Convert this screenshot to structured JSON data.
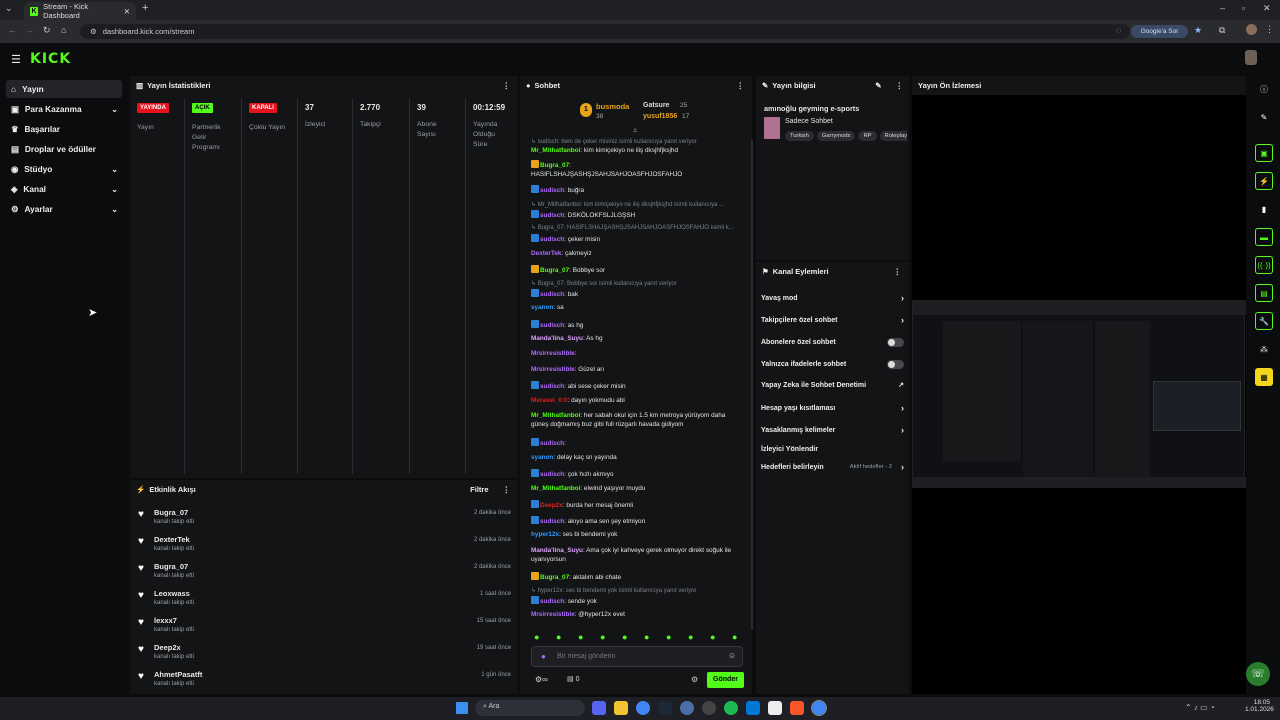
{
  "browser": {
    "tab_title": "Stream - Kick Dashboard",
    "url": "dashboard.kick.com/stream",
    "google_label": "Google'a Sor"
  },
  "sidebar": {
    "items": [
      {
        "label": "Yayın"
      },
      {
        "label": "Para Kazanma"
      },
      {
        "label": "Başarılar"
      },
      {
        "label": "Droplar ve ödüller"
      },
      {
        "label": "Stüdyo"
      },
      {
        "label": "Kanal"
      },
      {
        "label": "Ayarlar"
      }
    ]
  },
  "stats": {
    "title": "Yayın İstatistikleri",
    "badges": [
      {
        "text": "YAYINDA",
        "label": "Yayın"
      },
      {
        "text": "AÇIK",
        "label": "Partnerlik Gelir Programı"
      },
      {
        "text": "KAPALI",
        "label": "Çoklu Yayın"
      }
    ],
    "values": [
      {
        "value": "37",
        "label": "İzleyici"
      },
      {
        "value": "2.770",
        "label": "Takipçi"
      },
      {
        "value": "39",
        "label": "Abone Sayısı"
      },
      {
        "value": "00:12:59",
        "label": "Yayında Olduğu Süre"
      }
    ]
  },
  "activity": {
    "title": "Etkinlik Akışı",
    "filter": "Filtre",
    "rows": [
      {
        "name": "Bugra_07",
        "sub": "kanalı takip etti",
        "time": "2 dakika önce"
      },
      {
        "name": "DexterTek",
        "sub": "kanalı takip etti",
        "time": "2 dakika önce"
      },
      {
        "name": "Bugra_07",
        "sub": "kanalı takip etti",
        "time": "2 dakika önce"
      },
      {
        "name": "Leoxwass",
        "sub": "kanalı takip etti",
        "time": "1 saat önce"
      },
      {
        "name": "lexxx7",
        "sub": "kanalı takip etti",
        "time": "15 saat önce"
      },
      {
        "name": "Deep2x",
        "sub": "kanalı takip etti",
        "time": "19 saat önce"
      },
      {
        "name": "AhmetPasatft",
        "sub": "kanalı takip etti",
        "time": "1 gün önce"
      }
    ]
  },
  "chat": {
    "title": "Sohbet",
    "top": {
      "first": "busmoda",
      "first_count": "38",
      "second": "Gatsure",
      "second_count": "25",
      "third": "yusuf1856",
      "third_count": "17"
    },
    "messages": [
      {
        "reply": "sudisch: beni de çeker misiniz isimli kullanıcıya yanıt veriyor"
      },
      {
        "user": "Mr_Mithatfanboi",
        "color": "#53fc18",
        "text": "kim kimiçekiyo ne iliş dksjhfjksjhd"
      },
      {
        "user": "Bugra_07",
        "color": "#53fc18",
        "text": "",
        "badge": "#e8a31a"
      },
      {
        "text": "HASIFLSHAJŞASHŞJSAHJSAHJOASFHJOSFAHJO"
      },
      {
        "user": "sudisch",
        "color": "#b06bff",
        "text": "buğra",
        "badge": "#2d7fd6"
      },
      {
        "reply": "Mr_Mithatfanboi: kim kimiçekiyo ne iliş dksjhfjksjhd isimli kullanıcıya ..."
      },
      {
        "user": "sudisch",
        "color": "#b06bff",
        "text": "DSKÖLOKFSLJLGŞSH",
        "badge": "#2d7fd6"
      },
      {
        "reply": "Bugra_07: HASİFLSHAJŞASHŞJSAHJSAHJOASFHJOSFAHJO isimli k..."
      },
      {
        "user": "sudisch",
        "color": "#b06bff",
        "text": "çeker misin",
        "badge": "#2d7fd6"
      },
      {
        "user": "DexterTek",
        "color": "#b06bff",
        "text": "çakmeyiz"
      },
      {
        "user": "Bugra_07",
        "color": "#53fc18",
        "text": "Bobbye sor",
        "badge": "#e8a31a"
      },
      {
        "reply": "Bugra_07: Bobbye sor isimli kullanıcıya yanıt veriyor"
      },
      {
        "user": "sudisch",
        "color": "#b06bff",
        "text": "bak",
        "badge": "#2d7fd6"
      },
      {
        "user": "syanon",
        "color": "#2d9cff",
        "text": "sa"
      },
      {
        "user": "sudisch",
        "color": "#b06bff",
        "text": "as hg",
        "badge": "#2d7fd6"
      },
      {
        "user": "Manda'lina_Suyu",
        "color": "#e0a0ff",
        "text": "As hg"
      },
      {
        "user": "Mrsirresistible",
        "color": "#b06bff",
        "text": ""
      },
      {
        "user": "Mrsirresistible",
        "color": "#b06bff",
        "text": "Güzel arı"
      },
      {
        "user": "sudisch",
        "color": "#b06bff",
        "text": "abi sese çeker misin",
        "badge": "#2d7fd6"
      },
      {
        "user": "Merasel_0:0",
        "color": "#d22",
        "text": "dayın yokmudu abi"
      },
      {
        "user": "Mr_Mithatfanboi",
        "color": "#53fc18",
        "text": "her sabah okul için 1.5 km metroya yürüyom daha güneş doğmamış buz gibi full rüzgarlı havada gidiyom"
      },
      {
        "user": "sudisch",
        "color": "#b06bff",
        "text": "",
        "badge": "#2d7fd6"
      },
      {
        "user": "syanon",
        "color": "#2d9cff",
        "text": "delay kaç sn yayında"
      },
      {
        "user": "sudisch",
        "color": "#b06bff",
        "text": "çok hızlı akmıyo",
        "badge": "#2d7fd6"
      },
      {
        "user": "Mr_Mithatfanboi",
        "color": "#53fc18",
        "text": "elwind yaşıyor muydu"
      },
      {
        "user": "Deep2x",
        "color": "#d22",
        "text": "burda her mesaj önemli",
        "badge": "#2d7fd6"
      },
      {
        "user": "sudisch",
        "color": "#b06bff",
        "text": "akıyo ama sen şey etmiyon",
        "badge": "#2d7fd6"
      },
      {
        "user": "hyper12x",
        "color": "#2d9cff",
        "text": "ses bi bendemi yok"
      },
      {
        "user": "Manda'lina_Suyu",
        "color": "#e0a0ff",
        "text": "Ama çok iyi kahveye gerek olmuyor direkt soğuk ile uyanıyorsun"
      },
      {
        "user": "Bugra_07",
        "color": "#53fc18",
        "text": "aktalım abi chate",
        "badge": "#e8a31a"
      },
      {
        "reply": "hyper12x: ses bi bendemi yok isimli kullanıcıya yanıt veriyor"
      },
      {
        "user": "sudisch",
        "color": "#b06bff",
        "text": "sende yok",
        "badge": "#2d7fd6"
      },
      {
        "user": "Mrsirresistible",
        "color": "#b06bff",
        "text": "@hyper12x evet"
      }
    ],
    "input_placeholder": "Bir mesaj gönderin",
    "send_label": "Gönder",
    "counter": "0"
  },
  "stream_info": {
    "title": "Yayın bilgisi",
    "stream_title": "amınoğlu geyming e-sports",
    "category": "Sadece Sohbet",
    "tags": [
      "Turkish",
      "Garrymodx",
      "RP",
      "Roleplay"
    ]
  },
  "channel_actions": {
    "title": "Kanal Eylemleri",
    "items": [
      {
        "label": "Yavaş mod",
        "kind": "arrow"
      },
      {
        "label": "Takipçilere özel sohbet",
        "kind": "arrow"
      },
      {
        "label": "Abonelere özel sohbet",
        "kind": "toggle"
      },
      {
        "label": "Yalnızca ifadelerle sohbet",
        "kind": "toggle"
      },
      {
        "label": "Yapay Zeka ile Sohbet Denetimi",
        "kind": "ext"
      },
      {
        "label": "Hesap yaşı kısıtlaması",
        "kind": "arrow"
      },
      {
        "label": "Yasaklanmış kelimeler",
        "kind": "arrow"
      },
      {
        "label": "İzleyici Yönlendir",
        "kind": "none"
      },
      {
        "label": "Hedefleri belirleyin",
        "kind": "arrow",
        "extra": "Aktif hedefler - 2"
      }
    ]
  },
  "preview": {
    "title": "Yayın Ön İzlemesi"
  },
  "taskbar": {
    "search": "Ara",
    "time": "18:05",
    "date": "1.01.2026"
  },
  "colors": {
    "accent": "#53fc18",
    "panel": "#131416",
    "bg": "#0b0c0e"
  }
}
